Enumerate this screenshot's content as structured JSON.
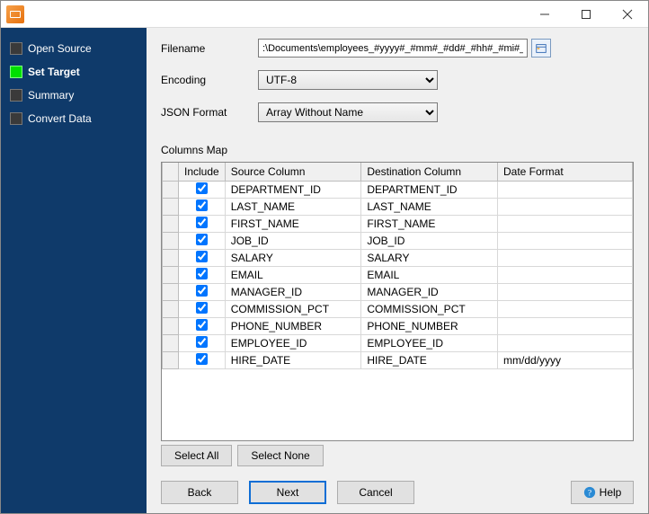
{
  "sidebar": {
    "items": [
      {
        "label": "Open Source",
        "active": false
      },
      {
        "label": "Set Target",
        "active": true
      },
      {
        "label": "Summary",
        "active": false
      },
      {
        "label": "Convert Data",
        "active": false
      }
    ]
  },
  "form": {
    "filename_label": "Filename",
    "filename_value": ":\\Documents\\employees_#yyyy#_#mm#_#dd#_#hh#_#mi#_#ss#.json",
    "encoding_label": "Encoding",
    "encoding_value": "UTF-8",
    "format_label": "JSON Format",
    "format_value": "Array Without Name",
    "columns_map_label": "Columns Map"
  },
  "grid": {
    "headers": {
      "include": "Include",
      "source": "Source Column",
      "dest": "Destination Column",
      "datefmt": "Date Format"
    },
    "rows": [
      {
        "include": true,
        "source": "DEPARTMENT_ID",
        "dest": "DEPARTMENT_ID",
        "datefmt": ""
      },
      {
        "include": true,
        "source": "LAST_NAME",
        "dest": "LAST_NAME",
        "datefmt": ""
      },
      {
        "include": true,
        "source": "FIRST_NAME",
        "dest": "FIRST_NAME",
        "datefmt": ""
      },
      {
        "include": true,
        "source": "JOB_ID",
        "dest": "JOB_ID",
        "datefmt": ""
      },
      {
        "include": true,
        "source": "SALARY",
        "dest": "SALARY",
        "datefmt": ""
      },
      {
        "include": true,
        "source": "EMAIL",
        "dest": "EMAIL",
        "datefmt": ""
      },
      {
        "include": true,
        "source": "MANAGER_ID",
        "dest": "MANAGER_ID",
        "datefmt": ""
      },
      {
        "include": true,
        "source": "COMMISSION_PCT",
        "dest": "COMMISSION_PCT",
        "datefmt": ""
      },
      {
        "include": true,
        "source": "PHONE_NUMBER",
        "dest": "PHONE_NUMBER",
        "datefmt": ""
      },
      {
        "include": true,
        "source": "EMPLOYEE_ID",
        "dest": "EMPLOYEE_ID",
        "datefmt": ""
      },
      {
        "include": true,
        "source": "HIRE_DATE",
        "dest": "HIRE_DATE",
        "datefmt": "mm/dd/yyyy"
      }
    ]
  },
  "buttons": {
    "select_all": "Select All",
    "select_none": "Select None",
    "back": "Back",
    "next": "Next",
    "cancel": "Cancel",
    "help": "Help"
  }
}
